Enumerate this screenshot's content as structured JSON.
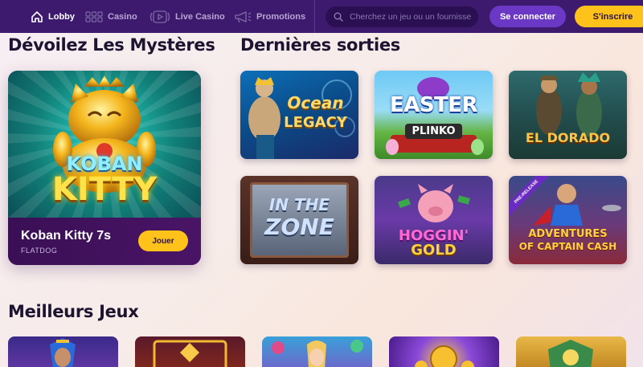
{
  "nav": {
    "items": [
      {
        "label": "Lobby",
        "icon": "home-icon",
        "active": true
      },
      {
        "label": "Casino",
        "icon": "grid-icon",
        "active": false
      },
      {
        "label": "Live Casino",
        "icon": "live-play-icon",
        "active": false
      },
      {
        "label": "Promotions",
        "icon": "megaphone-icon",
        "active": false
      }
    ],
    "search_placeholder": "Cherchez un jeu ou un fournisse",
    "login_label": "Se connecter",
    "signup_label": "S'inscrire"
  },
  "sections": {
    "mysteries_title": "Dévoilez Les Mystères",
    "latest_title": "Dernières sorties",
    "best_title": "Meilleurs Jeux"
  },
  "featured": {
    "art_line1": "KOBAN",
    "art_line2": "KITTY",
    "title": "Koban Kitty 7s",
    "provider": "FLATDOG",
    "play_label": "Jouer"
  },
  "latest_games": [
    {
      "line1": "Ocean",
      "line2": "LEGACY"
    },
    {
      "line1": "EASTER",
      "line2": "PLINKO"
    },
    {
      "line1": "EL DORADO",
      "line2": ""
    },
    {
      "line1": "IN THE",
      "line2": "ZONE"
    },
    {
      "line1": "HOGGIN'",
      "line2": "GOLD"
    },
    {
      "line1": "ADVENTURES",
      "line2": "OF CAPTAIN CASH",
      "badge": "PRE-RELEASE"
    }
  ],
  "colors": {
    "nav_bg": "#3d1a6e",
    "accent_yellow": "#ffc21a",
    "accent_purple": "#6a38c4"
  }
}
